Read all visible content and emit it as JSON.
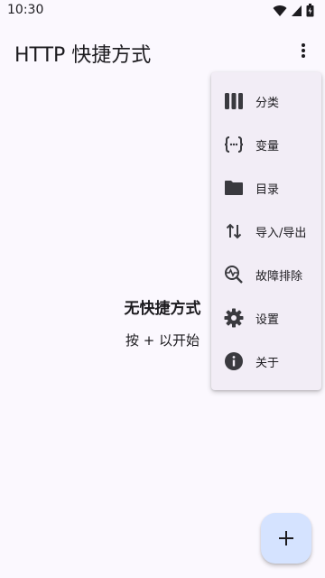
{
  "status_bar": {
    "time": "10:30",
    "icons": [
      "wifi-icon",
      "signal-icon",
      "battery-icon"
    ]
  },
  "app_bar": {
    "title": "HTTP 快捷方式",
    "overflow_icon": "more-vert-icon"
  },
  "empty_state": {
    "title": "无快捷方式",
    "subtitle": "按 + 以开始"
  },
  "menu": {
    "items": [
      {
        "label": "分类",
        "icon": "categories-icon"
      },
      {
        "label": "变量",
        "icon": "variables-icon"
      },
      {
        "label": "目录",
        "icon": "folder-icon"
      },
      {
        "label": "导入/导出",
        "icon": "import-export-icon"
      },
      {
        "label": "故障排除",
        "icon": "troubleshoot-icon"
      },
      {
        "label": "设置",
        "icon": "settings-icon"
      },
      {
        "label": "关于",
        "icon": "info-icon"
      }
    ]
  },
  "fab": {
    "icon": "plus-icon",
    "symbol": "+"
  },
  "colors": {
    "background": "#fbf8fe",
    "menu_background": "#f2edf6",
    "fab_background": "#d5e3ff",
    "text": "#1c1b1f",
    "icon": "#3a3a3f"
  }
}
